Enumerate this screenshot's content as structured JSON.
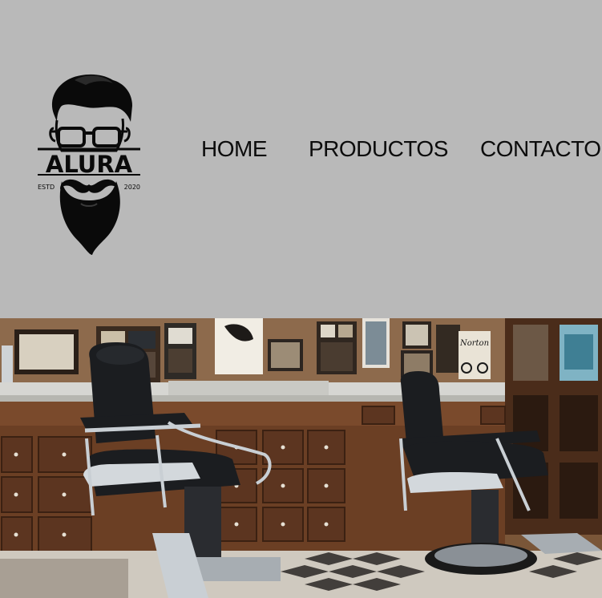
{
  "logo": {
    "brand": "ALURA",
    "estd": "ESTD",
    "year": "2020",
    "icon": "bearded-man-glasses-icon"
  },
  "nav": {
    "items": [
      {
        "label": "HOME"
      },
      {
        "label": "PRODUCTOS"
      },
      {
        "label": "CONTACTO"
      }
    ]
  },
  "hero": {
    "image": "barbershop-interior-photo",
    "poster_text": "Norton"
  },
  "colors": {
    "header_bg": "#b9b9b9",
    "nav_text": "#0c0c0c",
    "wood": "#6a4128",
    "chair_leather": "#1b1d20",
    "chrome": "#c9cfd4"
  }
}
